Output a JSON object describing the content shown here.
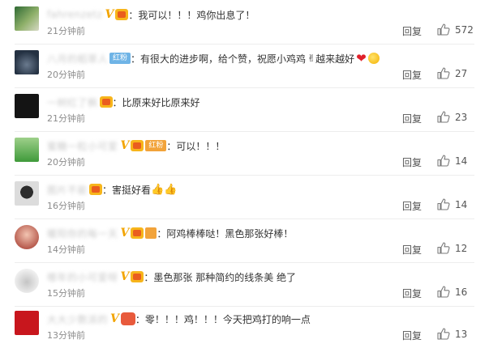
{
  "icons": {
    "like": "thumbs-up-icon",
    "verified": "v-badge-icon",
    "vip": "vip-crown-icon"
  },
  "colors": {
    "username": "#c9c9c9",
    "verified": "#f2a400",
    "time": "#8c8c8c",
    "text": "#333333",
    "heart": "#e0202a"
  },
  "comments": [
    {
      "text": "：我可以！！！鸡你出息了！",
      "time": "21分钟前",
      "reply": "回复",
      "likes": "572",
      "fan_badge": ""
    },
    {
      "text": "：有很大的进步啊，给个赞，祝愿小鸡鸡",
      "text_tail": " 越来越好",
      "time": "20分钟前",
      "reply": "回复",
      "likes": "27",
      "fan_badge": "红粉"
    },
    {
      "text": "：比原来好比原来好",
      "time": "21分钟前",
      "reply": "回复",
      "likes": "23",
      "fan_badge": ""
    },
    {
      "text": "：可以！！！",
      "time": "20分钟前",
      "reply": "回复",
      "likes": "14",
      "fan_badge": "红粉"
    },
    {
      "text": "：害挺好看",
      "time": "16分钟前",
      "reply": "回复",
      "likes": "14",
      "fan_badge": ""
    },
    {
      "text": "：阿鸡棒棒哒！黑色那张好棒！",
      "time": "14分钟前",
      "reply": "回复",
      "likes": "12",
      "fan_badge": ""
    },
    {
      "text": "：墨色那张  那种简约的线条美 绝了",
      "time": "15分钟前",
      "reply": "回复",
      "likes": "16",
      "fan_badge": ""
    },
    {
      "text": "：零！！！鸡！！！今天把鸡打的响一点",
      "time": "13分钟前",
      "reply": "回复",
      "likes": "13",
      "fan_badge": ""
    }
  ]
}
